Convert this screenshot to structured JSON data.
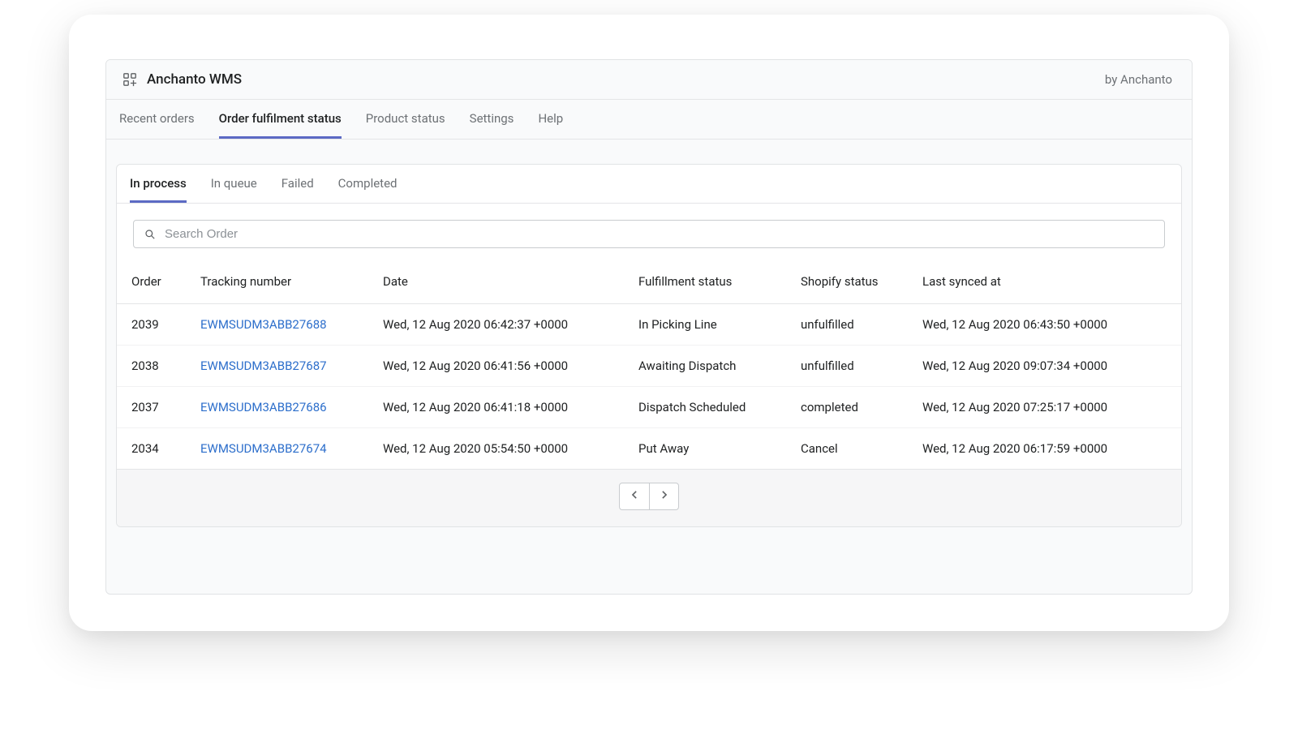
{
  "header": {
    "title": "Anchanto WMS",
    "byline": "by Anchanto"
  },
  "main_tabs": [
    {
      "label": "Recent orders",
      "active": false
    },
    {
      "label": "Order fulfilment status",
      "active": true
    },
    {
      "label": "Product status",
      "active": false
    },
    {
      "label": "Settings",
      "active": false
    },
    {
      "label": "Help",
      "active": false
    }
  ],
  "sub_tabs": [
    {
      "label": "In process",
      "active": true
    },
    {
      "label": "In queue",
      "active": false
    },
    {
      "label": "Failed",
      "active": false
    },
    {
      "label": "Completed",
      "active": false
    }
  ],
  "search": {
    "placeholder": "Search Order",
    "value": ""
  },
  "table": {
    "columns": [
      "Order",
      "Tracking number",
      "Date",
      "Fulfillment status",
      "Shopify status",
      "Last synced at"
    ],
    "rows": [
      {
        "order": "2039",
        "tracking": "EWMSUDM3ABB27688",
        "date": "Wed, 12 Aug 2020 06:42:37 +0000",
        "fulfillment": "In Picking Line",
        "shopify": "unfulfilled",
        "synced": "Wed, 12 Aug 2020 06:43:50 +0000"
      },
      {
        "order": "2038",
        "tracking": "EWMSUDM3ABB27687",
        "date": "Wed, 12 Aug 2020 06:41:56 +0000",
        "fulfillment": "Awaiting Dispatch",
        "shopify": "unfulfilled",
        "synced": "Wed, 12 Aug 2020 09:07:34 +0000"
      },
      {
        "order": "2037",
        "tracking": "EWMSUDM3ABB27686",
        "date": "Wed, 12 Aug 2020 06:41:18 +0000",
        "fulfillment": "Dispatch Scheduled",
        "shopify": "completed",
        "synced": "Wed, 12 Aug 2020 07:25:17 +0000"
      },
      {
        "order": "2034",
        "tracking": "EWMSUDM3ABB27674",
        "date": "Wed, 12 Aug 2020 05:54:50 +0000",
        "fulfillment": "Put Away",
        "shopify": "Cancel",
        "synced": "Wed, 12 Aug 2020 06:17:59 +0000"
      }
    ]
  }
}
